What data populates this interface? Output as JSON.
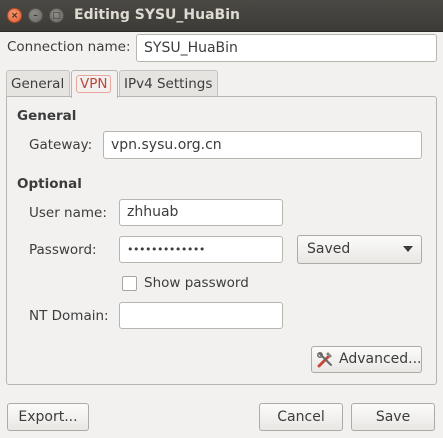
{
  "window": {
    "title": "Editing SYSU_HuaBin",
    "close_glyph": "×",
    "minimize_glyph": "–",
    "maximize_glyph": "□"
  },
  "connection": {
    "name_label": "Connection name:",
    "name_value": "SYSU_HuaBin"
  },
  "tabs": [
    {
      "label": "General"
    },
    {
      "label": "VPN"
    },
    {
      "label": "IPv4 Settings"
    }
  ],
  "vpn": {
    "general_heading": "General",
    "gateway_label": "Gateway:",
    "gateway_value": "vpn.sysu.org.cn",
    "optional_heading": "Optional",
    "username_label": "User name:",
    "username_value": "zhhuab",
    "password_label": "Password:",
    "password_value": "•••••••••••••",
    "password_store": "Saved",
    "show_password_label": "Show password",
    "show_password_checked": false,
    "nt_domain_label": "NT Domain:",
    "nt_domain_value": "",
    "advanced_label": "Advanced..."
  },
  "footer": {
    "export_label": "Export...",
    "cancel_label": "Cancel",
    "save_label": "Save"
  },
  "icons": {
    "advanced_icon": "tools-icon"
  }
}
